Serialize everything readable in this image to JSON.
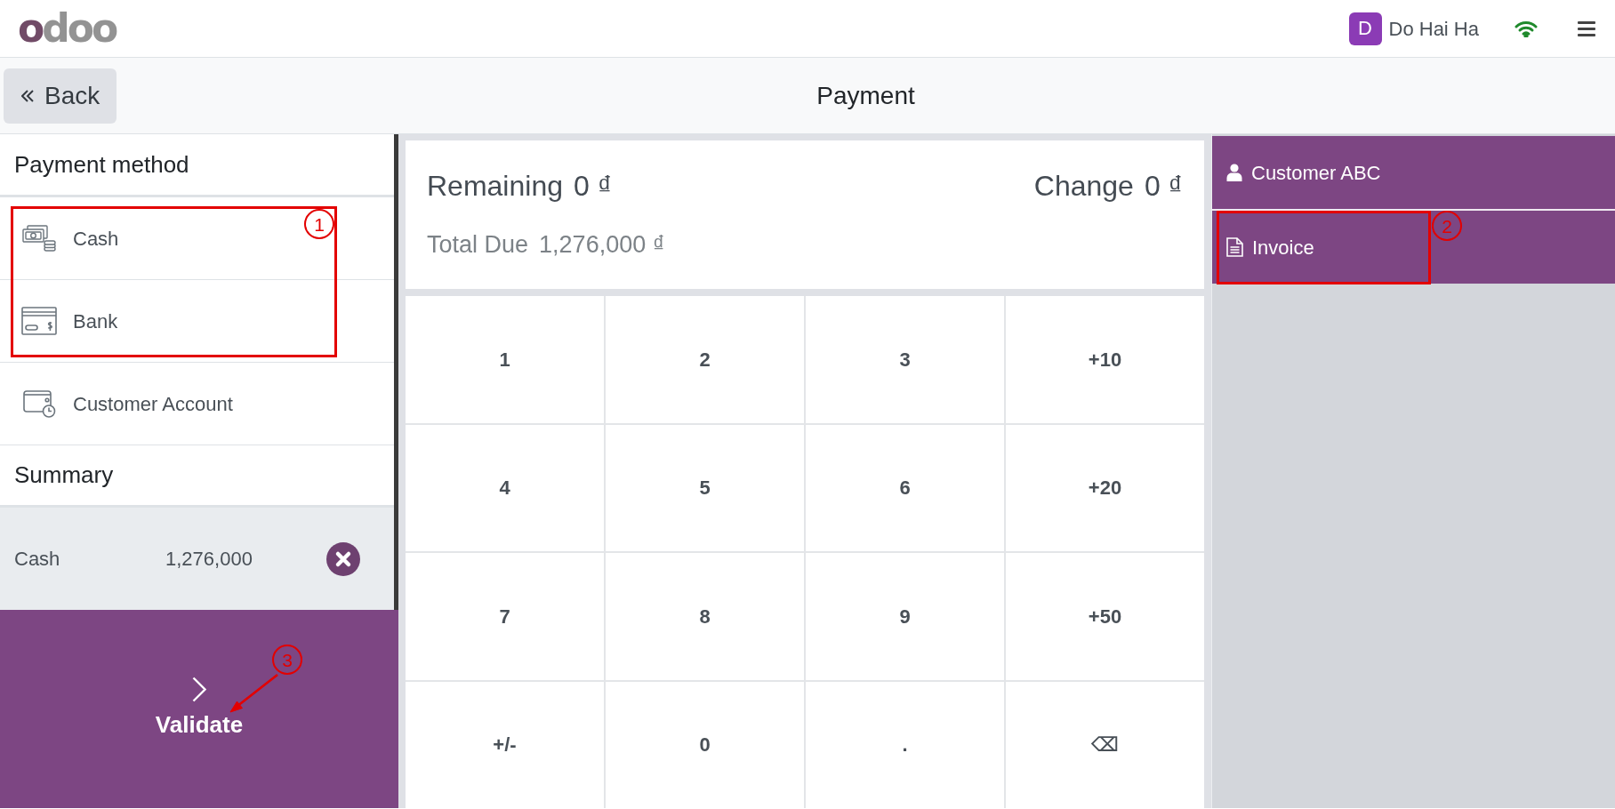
{
  "header": {
    "logo": "odoo",
    "user": {
      "initial": "D",
      "name": "Do Hai Ha"
    }
  },
  "toolbar": {
    "back_label": "Back",
    "title": "Payment"
  },
  "payment_methods": {
    "title": "Payment method",
    "items": [
      {
        "kind": "cash",
        "name": "Cash"
      },
      {
        "kind": "bank",
        "name": "Bank"
      },
      {
        "kind": "account",
        "name": "Customer Account"
      }
    ]
  },
  "summary": {
    "title": "Summary",
    "lines": [
      {
        "method": "Cash",
        "amount": "1,276,000",
        "selected": true
      }
    ]
  },
  "validate": {
    "label": "Validate"
  },
  "totals": {
    "remaining": {
      "label": "Remaining",
      "amount": "0 ₫"
    },
    "change": {
      "label": "Change",
      "amount": "0 ₫"
    },
    "total_due": {
      "label": "Total Due",
      "amount": "1,276,000 ₫"
    }
  },
  "keypad": [
    "1",
    "2",
    "3",
    "+10",
    "4",
    "5",
    "6",
    "+20",
    "7",
    "8",
    "9",
    "+50",
    "+/-",
    "0",
    ".",
    "⌫"
  ],
  "actions": [
    {
      "kind": "customer",
      "label": "Customer ABC"
    },
    {
      "kind": "invoice",
      "label": "Invoice"
    }
  ],
  "annotations": [
    {
      "kind": "box",
      "label": "1"
    },
    {
      "kind": "box",
      "label": "2"
    },
    {
      "kind": "arrow",
      "label": "3"
    }
  ]
}
